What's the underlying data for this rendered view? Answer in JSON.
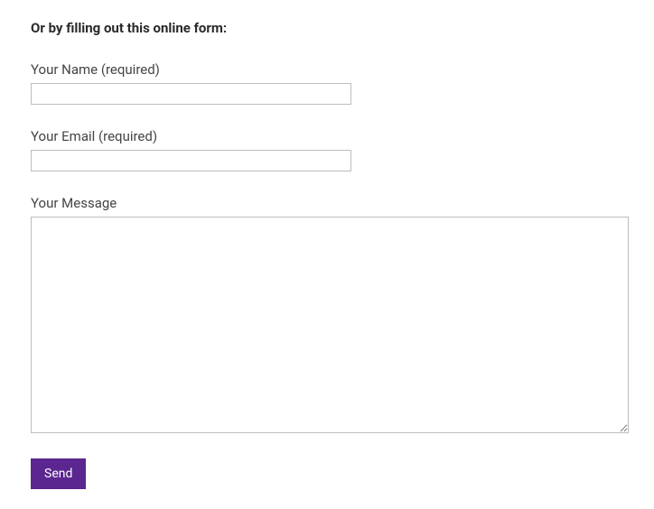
{
  "form": {
    "heading": "Or by filling out this online form:",
    "name": {
      "label": "Your Name (required)",
      "value": ""
    },
    "email": {
      "label": "Your Email (required)",
      "value": ""
    },
    "message": {
      "label": "Your Message",
      "value": ""
    },
    "submit_label": "Send"
  }
}
